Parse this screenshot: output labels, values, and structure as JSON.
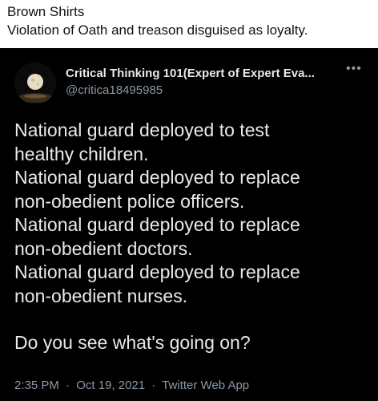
{
  "caption": {
    "line1": "Brown Shirts",
    "line2": "Violation of Oath and treason disguised as loyalty."
  },
  "tweet": {
    "author_name": "Critical Thinking 101(Expert of Expert Eva...",
    "author_handle": "@critica18495985",
    "avatar_icon": "moon-avatar-icon",
    "more_icon": "more-options-icon",
    "body_lines": [
      "National guard deployed to test",
      "healthy children.",
      "National guard deployed to replace",
      "non-obedient police officers.",
      "National guard deployed to replace",
      "non-obedient doctors.",
      "National guard deployed to replace",
      "non-obedient nurses."
    ],
    "question": "Do you see what's going on?",
    "time": "2:35 PM",
    "date": "Oct 19, 2021",
    "source": "Twitter Web App",
    "separator": "·"
  },
  "colors": {
    "tweet_background": "#000000",
    "tweet_text": "#e7e9ea",
    "secondary_text": "#8b98a5",
    "caption_background": "#ffffff",
    "caption_text": "#111111"
  }
}
